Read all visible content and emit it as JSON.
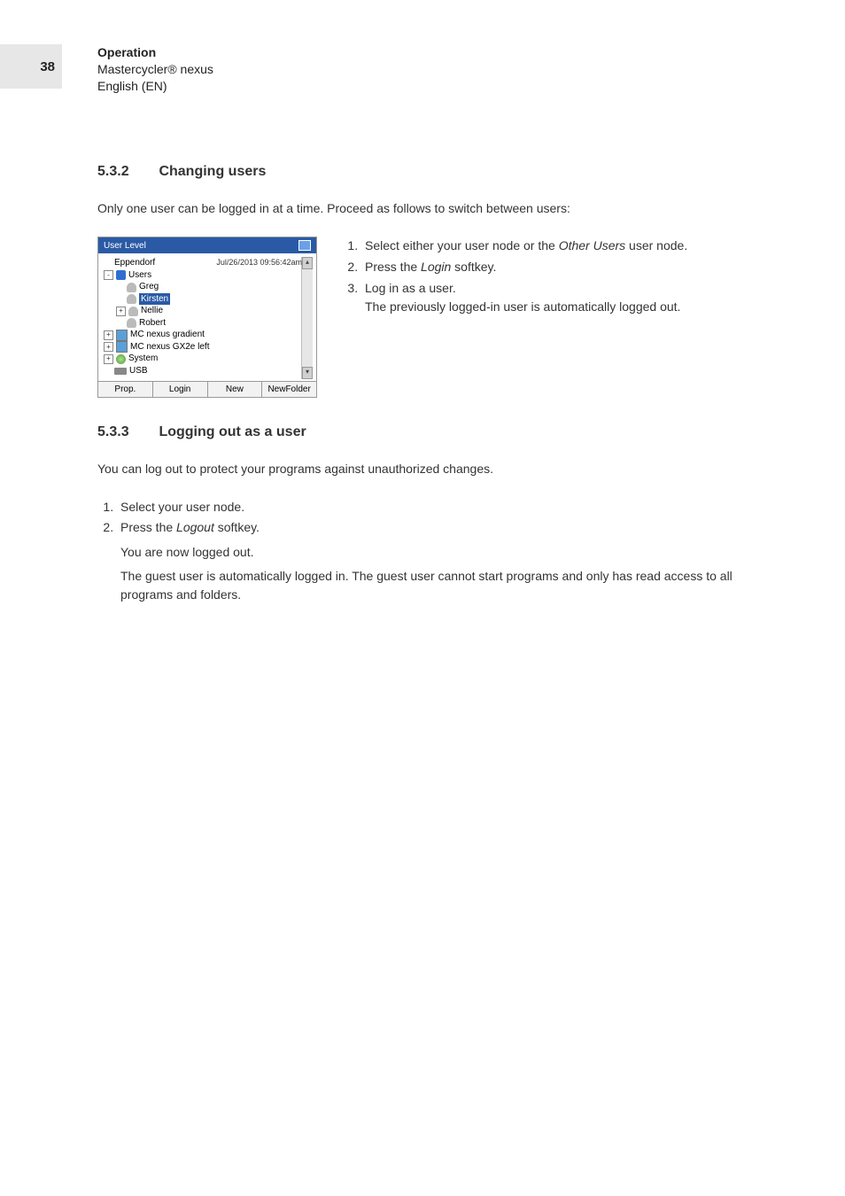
{
  "page_number": "38",
  "header": {
    "title": "Operation",
    "product": "Mastercycler® nexus",
    "lang": "English (EN)"
  },
  "section_a": {
    "num": "5.3.2",
    "title": "Changing users",
    "intro": "Only one user can be logged in at a time. Proceed as follows to switch between users:",
    "steps": {
      "s1a": "Select either your user node or the ",
      "s1b": "Other Users",
      "s1c": " user node.",
      "s2a": "Press the ",
      "s2b": "Login",
      "s2c": " softkey.",
      "s3": "Log in as a user.",
      "s3_follow": "The previously logged-in user is automatically logged out."
    }
  },
  "device": {
    "title": "User Level",
    "timestamp": "Jul/26/2013 09:56:42am",
    "tree": {
      "root": "Eppendorf",
      "users_label": "Users",
      "u1": "Greg",
      "u2": "Kirsten",
      "u3": "Nellie",
      "u4": "Robert",
      "cycler1": "MC nexus gradient",
      "cycler2": "MC nexus GX2e left",
      "system": "System",
      "usb": "USB"
    },
    "softkeys": {
      "k1": "Prop.",
      "k2": "Login",
      "k3": "New",
      "k4": "NewFolder"
    }
  },
  "section_b": {
    "num": "5.3.3",
    "title": "Logging out as a user",
    "intro": "You can log out to protect your programs against unauthorized changes.",
    "steps": {
      "s1": "Select your user node.",
      "s2a": "Press the ",
      "s2b": "Logout",
      "s2c": " softkey."
    },
    "result1": "You are now logged out.",
    "result2": "The guest user is automatically logged in. The guest user cannot start programs and only has read access to all programs and folders."
  }
}
